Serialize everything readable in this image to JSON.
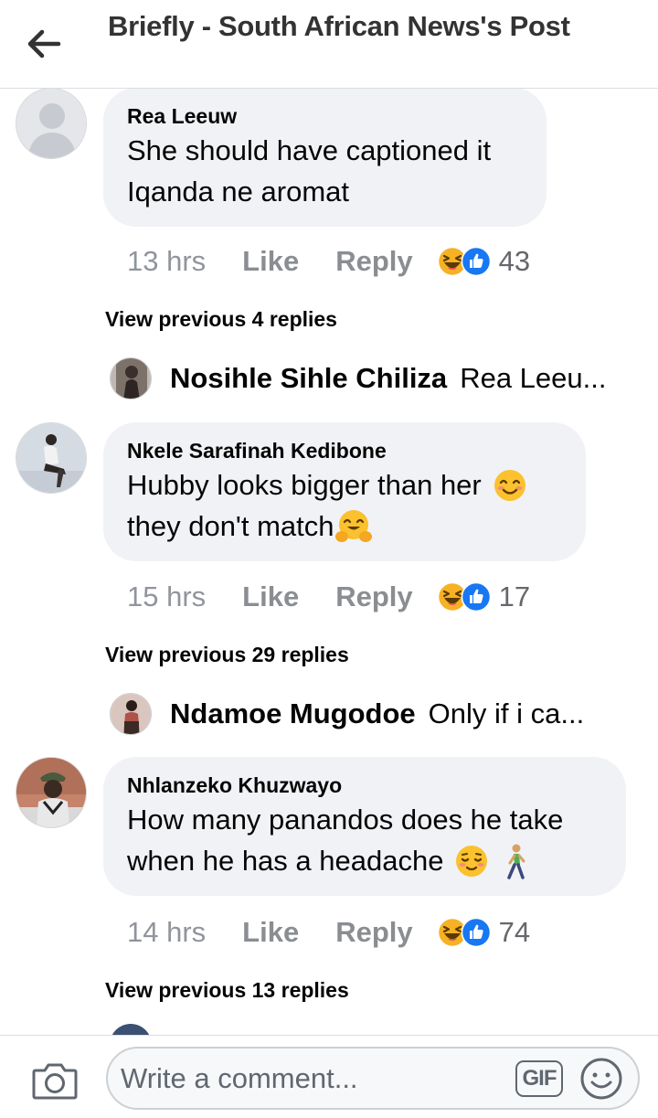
{
  "header": {
    "title": "Briefly - South African News's Post"
  },
  "comments": [
    {
      "author": "Rea Leeuw",
      "text_lines": [
        "She should have captioned it",
        "Iqanda ne aromat"
      ],
      "time": "13 hrs",
      "like_label": "Like",
      "reply_label": "Reply",
      "reaction_count": "43",
      "view_previous": "View previous 4 replies",
      "latest_reply": {
        "author": "Nosihle Sihle Chiliza",
        "snippet": "Rea Leeu..."
      }
    },
    {
      "author": "Nkele Sarafinah Kedibone",
      "text_lines": [
        "Hubby looks bigger than her",
        "they don't match"
      ],
      "time": "15 hrs",
      "like_label": "Like",
      "reply_label": "Reply",
      "reaction_count": "17",
      "view_previous": "View previous 29 replies",
      "latest_reply": {
        "author": "Ndamoe Mugodoe",
        "snippet": "Only if i ca..."
      }
    },
    {
      "author": "Nhlanzeko Khuzwayo",
      "text_lines": [
        "How many panandos does he take",
        "when he has a headache"
      ],
      "time": "14 hrs",
      "like_label": "Like",
      "reply_label": "Reply",
      "reaction_count": "74",
      "view_previous": "View previous 13 replies"
    }
  ],
  "composer": {
    "placeholder": "Write a comment...",
    "gif_label": "GIF"
  },
  "icons": {
    "back": "arrow-left-icon",
    "camera": "camera-icon",
    "emoji": "smiley-icon",
    "reactions": [
      "haha-reaction-icon",
      "like-reaction-icon"
    ]
  },
  "colors": {
    "bubble": "#f0f2f5",
    "meta_text": "#8a8d91",
    "like_blue": "#1877f2",
    "haha_yellow": "#f7b125"
  }
}
